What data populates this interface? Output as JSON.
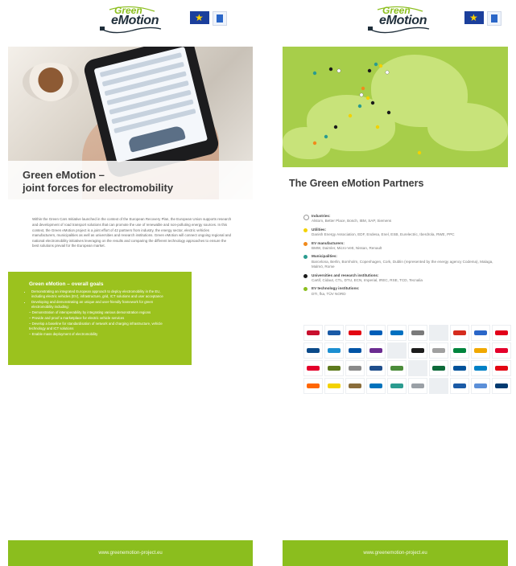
{
  "brand": {
    "logo_top": "Green",
    "logo_bottom": "eMotion",
    "green": "#8bbe1e",
    "dark": "#1f2e3a"
  },
  "left": {
    "title": "Green eMotion –\njoint forces for electromobility",
    "intro": "Within the Green Cars Initiative launched in the context of the European Recovery Plan, the European Union supports research and development of road transport solutions that can promote the use of renewable and non-polluting energy sources. In this context, the Green eMotion project is a joint effort of 42 partners from industry, the energy sector, electric vehicles manufacturers, municipalities as well as universities and research institutions. Green eMotion will connect ongoing regional and national electromobility initiatives leveraging on the results and comparing the different technology approaches to ensure the best solutions prevail for the European market.",
    "goals": {
      "heading": "Green eMotion – overall goals",
      "items": [
        "Demonstrating an integrated European approach to deploy electromobility in the EU, including electric vehicles (EV), infrastructure, grid, ICT solutions and user acceptance",
        "Developing and demonstrating an unique and user-friendly framework for green electromobility including:"
      ],
      "subitems": [
        "Demonstration of interoperability by integrating various demonstration regions",
        "Provide and proof a marketplace for electric vehicle services",
        "Develop a baseline for standardisation of network and charging infrastructure, vehicle technology and ICT solutions",
        "Enable mass deployment of electromobility"
      ]
    },
    "footer": "www.greenemotion-project.eu"
  },
  "right": {
    "title": "The Green eMotion Partners",
    "legend": [
      {
        "category": "Industries:",
        "items": "Alstom, Better Place, Bosch, IBM, SAP, Siemens",
        "color": "#ffffff"
      },
      {
        "category": "Utilities:",
        "items": "Danish Energy Association, EDF, Endesa, Enel, ESB, Eurelectric, Iberdrola, RWE, PPC",
        "color": "#f3d200"
      },
      {
        "category": "EV manufacturers:",
        "items": "BMW, Daimler, Micro-Vett, Nissan, Renault",
        "color": "#f08a1c"
      },
      {
        "category": "Municipalities:",
        "items": "Barcelona, Berlin, Bornholm, Copenhagen, Cork, Dublin (represented by the energy agency Codema), Malaga, Malmö, Rome",
        "color": "#2a9b8f"
      },
      {
        "category": "Universities and research institutions:",
        "items": "Cartif, Cidaut, CTL, DTU, ECN, Imperial, IREC, RSE, TCD, Tecnalia",
        "color": "#1a1a1a"
      },
      {
        "category": "EV technology institutions:",
        "items": "DTI, fka, TÜV NORD",
        "color": "#8bbe1e"
      }
    ],
    "footer": "www.greenemotion-project.eu",
    "logo_colors": [
      "#c8102e",
      "#1a5aa6",
      "#e30613",
      "#005eb8",
      "#0070c0",
      "#7a7a7a",
      "#eceff2",
      "#d52b1e",
      "#2a66c8",
      "#e2001a",
      "#0a4a8a",
      "#1c8fd1",
      "#0054a6",
      "#6b2c91",
      "#eceff2",
      "#1c1c1c",
      "#a0a0a0",
      "#00843d",
      "#f0a800",
      "#e4002b",
      "#e4002b",
      "#5e7a1e",
      "#8a8a8a",
      "#1f4e8c",
      "#4b8c3a",
      "#eceff2",
      "#0d6a3a",
      "#00529b",
      "#0081c6",
      "#e30613",
      "#ff6600",
      "#f3d200",
      "#8a6d3b",
      "#0072bc",
      "#2a9b8f",
      "#9aa0a6",
      "#eceff2",
      "#1a5aa6",
      "#5b8fd8",
      "#003a70"
    ]
  }
}
